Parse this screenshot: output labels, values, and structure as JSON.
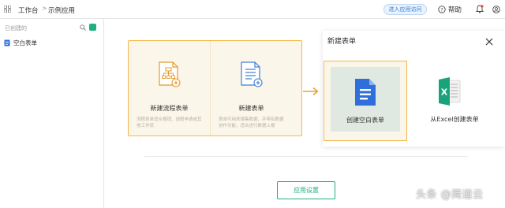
{
  "breadcrumb": {
    "workbench": "工作台",
    "separator": ">",
    "current": "示例应用"
  },
  "header": {
    "enter_app_label": "进入应用访问",
    "help_label": "帮助"
  },
  "sidebar": {
    "created_label": "已创建的",
    "items": [
      {
        "label": "空白表单"
      }
    ]
  },
  "cards": [
    {
      "title": "新建流程表单",
      "description": "流程表单适合报销、请假申请或其他工作流"
    },
    {
      "title": "新建表单",
      "description": "表单可用来搜集数据，并带有数据协作功能，适合进行数据上报"
    }
  ],
  "panel": {
    "title": "新建表单",
    "options": [
      {
        "label": "创建空白表单"
      },
      {
        "label": "从Excel创建表单"
      }
    ]
  },
  "footer": {
    "settings_label": "应用设置"
  },
  "watermark": "头条 @简道云",
  "colors": {
    "accent_green": "#21b07b",
    "highlight_orange": "#f5b64a",
    "doc_blue": "#2f6fdc",
    "excel_green": "#1aa37a"
  }
}
